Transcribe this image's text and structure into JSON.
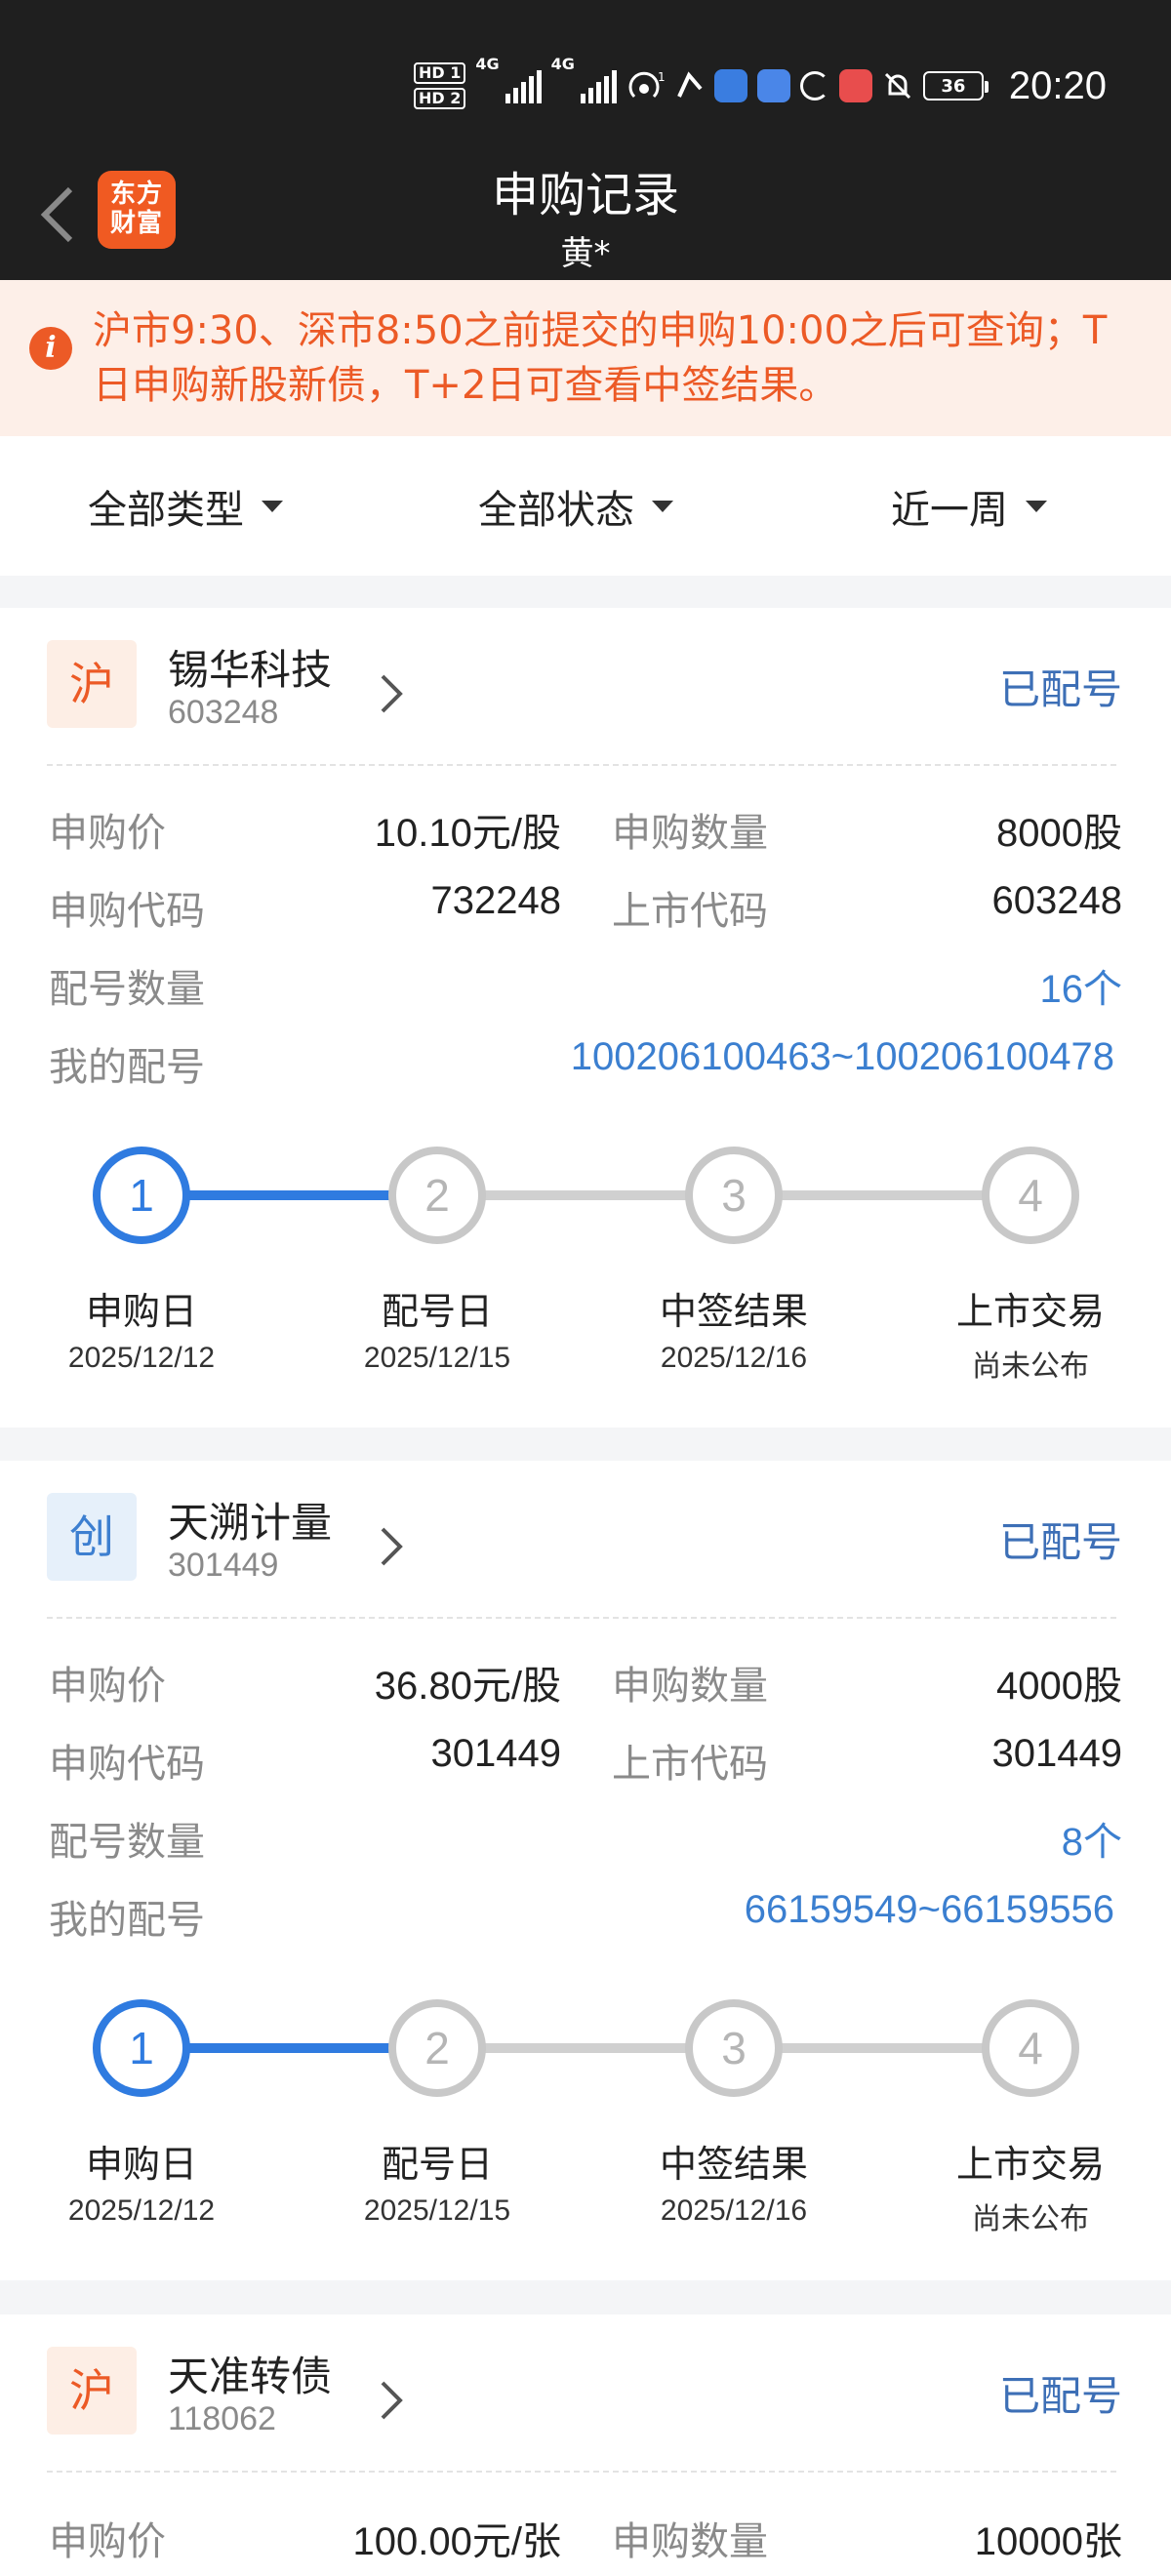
{
  "status_bar": {
    "time": "20:20",
    "battery": "36",
    "signal_labels": [
      "HD 1",
      "HD 2",
      "4G",
      "4G"
    ],
    "icons": [
      "hd-icon",
      "signal-icon",
      "hotspot-icon",
      "nfc-icon",
      "app-icon",
      "app-icon",
      "ring-icon",
      "app-icon",
      "mute-icon",
      "battery-icon"
    ]
  },
  "header": {
    "logo_text": "东方财富",
    "title": "申购记录",
    "subtitle": "黄*"
  },
  "notice": {
    "icon": "i",
    "text": "沪市9:30、深市8:50之前提交的申购10:00之后可查询；T日申购新股新债，T+2日可查看中签结果。"
  },
  "filters": {
    "type": "全部类型",
    "status": "全部状态",
    "period": "近一周"
  },
  "labels": {
    "price": "申购价",
    "qty": "申购数量",
    "sub_code": "申购代码",
    "list_code": "上市代码",
    "match_count": "配号数量",
    "my_match": "我的配号"
  },
  "steps": [
    "申购日",
    "配号日",
    "中签结果",
    "上市交易"
  ],
  "records": [
    {
      "market": "沪",
      "name": "锡华科技",
      "code": "603248",
      "status": "已配号",
      "price": "10.10元/股",
      "qty": "8000股",
      "sub_code": "732248",
      "list_code": "603248",
      "match_count": "16个",
      "my_match": "100206100463~100206100478",
      "step_nums": [
        "1",
        "2",
        "3",
        "4"
      ],
      "step_dates": [
        "2025/12/12",
        "2025/12/15",
        "2025/12/16",
        "尚未公布"
      ],
      "current_step": 1
    },
    {
      "market": "创",
      "name": "天溯计量",
      "code": "301449",
      "status": "已配号",
      "price": "36.80元/股",
      "qty": "4000股",
      "sub_code": "301449",
      "list_code": "301449",
      "match_count": "8个",
      "my_match": "66159549~66159556",
      "step_nums": [
        "1",
        "2",
        "3",
        "4"
      ],
      "step_dates": [
        "2025/12/12",
        "2025/12/15",
        "2025/12/16",
        "尚未公布"
      ],
      "current_step": 1
    },
    {
      "market": "沪",
      "name": "天准转债",
      "code": "118062",
      "status": "已配号",
      "price": "100.00元/张",
      "qty": "10000张"
    }
  ],
  "colors": {
    "accent_blue": "#2f7be0",
    "link_blue": "#3b7fd0",
    "warn_orange": "#ec5a26",
    "header_bg": "#1f1f1f"
  }
}
